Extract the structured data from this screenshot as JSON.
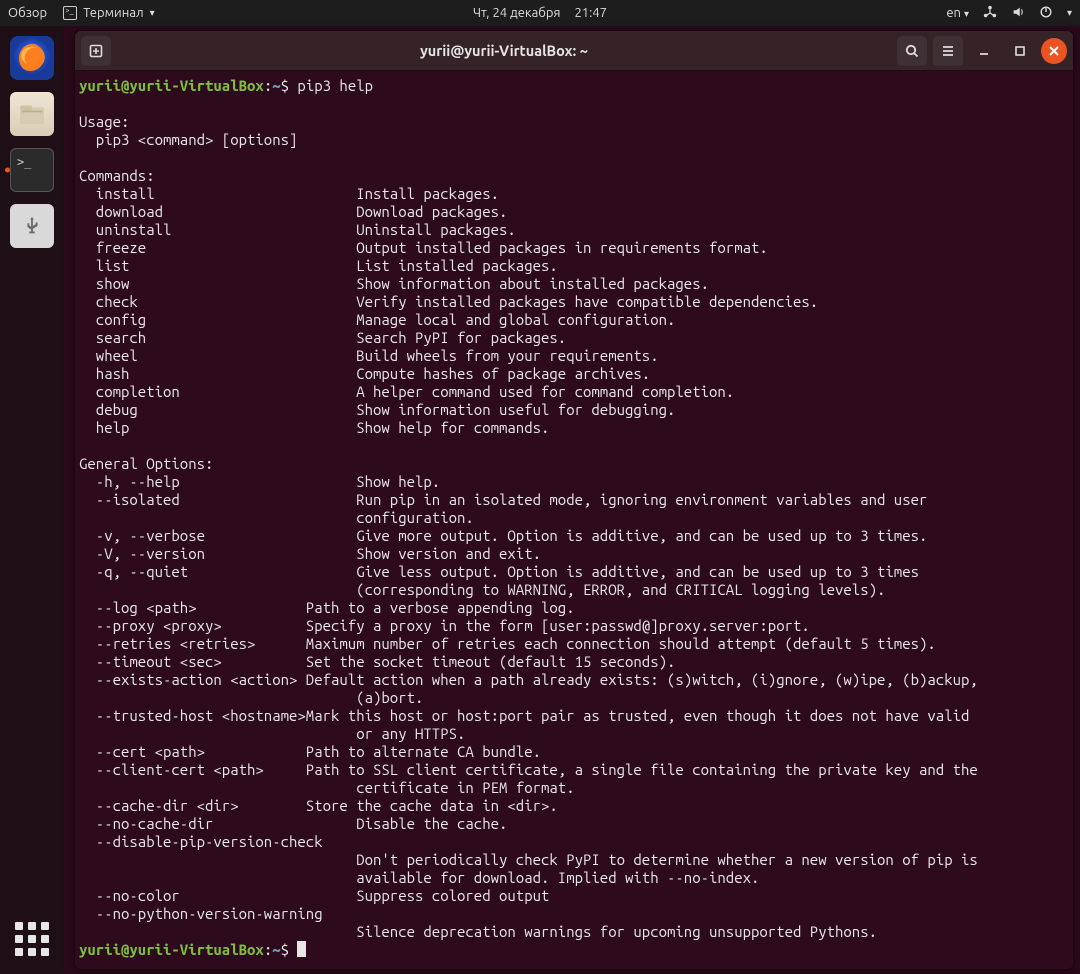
{
  "topbar": {
    "activities": "Обзор",
    "appmenu": "Терминал",
    "date": "Чт, 24 декабря",
    "time": "21:47",
    "lang": "en"
  },
  "window": {
    "title": "yurii@yurii-VirtualBox: ~"
  },
  "prompt": {
    "user": "yurii",
    "host": "yurii-VirtualBox",
    "path": "~",
    "cmd": "pip3 help"
  },
  "help": {
    "usage_hdr": "Usage:",
    "usage_line": "pip3 <command> [options]",
    "commands_hdr": "Commands:",
    "commands": [
      [
        "install",
        "Install packages."
      ],
      [
        "download",
        "Download packages."
      ],
      [
        "uninstall",
        "Uninstall packages."
      ],
      [
        "freeze",
        "Output installed packages in requirements format."
      ],
      [
        "list",
        "List installed packages."
      ],
      [
        "show",
        "Show information about installed packages."
      ],
      [
        "check",
        "Verify installed packages have compatible dependencies."
      ],
      [
        "config",
        "Manage local and global configuration."
      ],
      [
        "search",
        "Search PyPI for packages."
      ],
      [
        "wheel",
        "Build wheels from your requirements."
      ],
      [
        "hash",
        "Compute hashes of package archives."
      ],
      [
        "completion",
        "A helper command used for command completion."
      ],
      [
        "debug",
        "Show information useful for debugging."
      ],
      [
        "help",
        "Show help for commands."
      ]
    ],
    "genopts_hdr": "General Options:",
    "genopts": [
      [
        "-h, --help",
        "Show help."
      ],
      [
        "--isolated",
        "Run pip in an isolated mode, ignoring environment variables and user configuration."
      ],
      [
        "-v, --verbose",
        "Give more output. Option is additive, and can be used up to 3 times."
      ],
      [
        "-V, --version",
        "Show version and exit."
      ],
      [
        "-q, --quiet",
        "Give less output. Option is additive, and can be used up to 3 times (corresponding to WARNING, ERROR, and CRITICAL logging levels)."
      ],
      [
        "--log <path>",
        "Path to a verbose appending log."
      ],
      [
        "--proxy <proxy>",
        "Specify a proxy in the form [user:passwd@]proxy.server:port."
      ],
      [
        "--retries <retries>",
        "Maximum number of retries each connection should attempt (default 5 times)."
      ],
      [
        "--timeout <sec>",
        "Set the socket timeout (default 15 seconds)."
      ],
      [
        "--exists-action <action>",
        "Default action when a path already exists: (s)witch, (i)gnore, (w)ipe, (b)ackup, (a)bort."
      ],
      [
        "--trusted-host <hostname>",
        "Mark this host or host:port pair as trusted, even though it does not have valid or any HTTPS."
      ],
      [
        "--cert <path>",
        "Path to alternate CA bundle."
      ],
      [
        "--client-cert <path>",
        "Path to SSL client certificate, a single file containing the private key and the certificate in PEM format."
      ],
      [
        "--cache-dir <dir>",
        "Store the cache data in <dir>."
      ],
      [
        "--no-cache-dir",
        "Disable the cache."
      ],
      [
        "--disable-pip-version-check",
        ""
      ],
      [
        "",
        "Don't periodically check PyPI to determine whether a new version of pip is available for download. Implied with --no-index."
      ],
      [
        "--no-color",
        "Suppress colored output"
      ],
      [
        "--no-python-version-warning",
        ""
      ],
      [
        "",
        "Silence deprecation warnings for upcoming unsupported Pythons."
      ]
    ]
  }
}
